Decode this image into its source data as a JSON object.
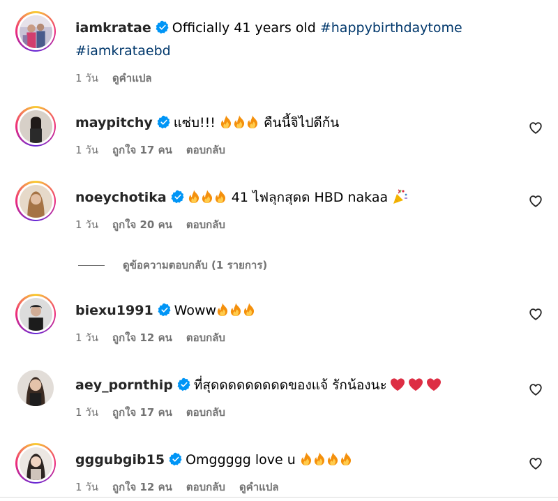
{
  "colors": {
    "verified": "#0095f6",
    "hashtag": "#00376b",
    "meta": "#737373",
    "heart_red": "#e0245e"
  },
  "icons": {
    "verified": "verified-badge-icon",
    "like": "heart-outline-icon",
    "fire": "fire-emoji",
    "heart_emoji": "red-heart-emoji",
    "party": "party-popper-emoji"
  },
  "post": {
    "username": "iamkratae",
    "text": "Officially 41 years old",
    "hashtag1": "#happybirthdaytome",
    "hashtag2": "#iamkrataebd",
    "time": "1 วัน",
    "translate": "ดูคำแปล"
  },
  "comments": [
    {
      "username": "maypitchy",
      "text_before": "แซ่บ!!!",
      "fires": 3,
      "text_after": "คืนนี้จิไปดีก้น",
      "time": "1 วัน",
      "likes": "ถูกใจ 17 คน",
      "reply": "ตอบกลับ"
    },
    {
      "username": "noeychotika",
      "text_before": "",
      "fires": 3,
      "text_after": "41 ไฟลุกสุดด HBD nakaa",
      "time": "1 วัน",
      "likes": "ถูกใจ 20 คน",
      "reply": "ตอบกลับ"
    },
    {
      "username": "biexu1991",
      "text_before": "Woww",
      "fires": 3,
      "text_after": "",
      "time": "1 วัน",
      "likes": "ถูกใจ 12 คน",
      "reply": "ตอบกลับ"
    },
    {
      "username": "aey_pornthip",
      "text_before": "ที่สุดดดดดดดดดของแจ้ รักน้องนะ",
      "fires": 0,
      "text_after": "",
      "time": "1 วัน",
      "likes": "ถูกใจ 17 คน",
      "reply": "ตอบกลับ"
    },
    {
      "username": "gggubgib15",
      "text_before": "Omggggg love u",
      "fires": 4,
      "text_after": "",
      "time": "1 วัน",
      "likes": "ถูกใจ 12 คน",
      "reply": "ตอบกลับ",
      "translate": "ดูคำแปล"
    }
  ],
  "view_replies": "ดูข้อความตอบกลับ (1 รายการ)"
}
